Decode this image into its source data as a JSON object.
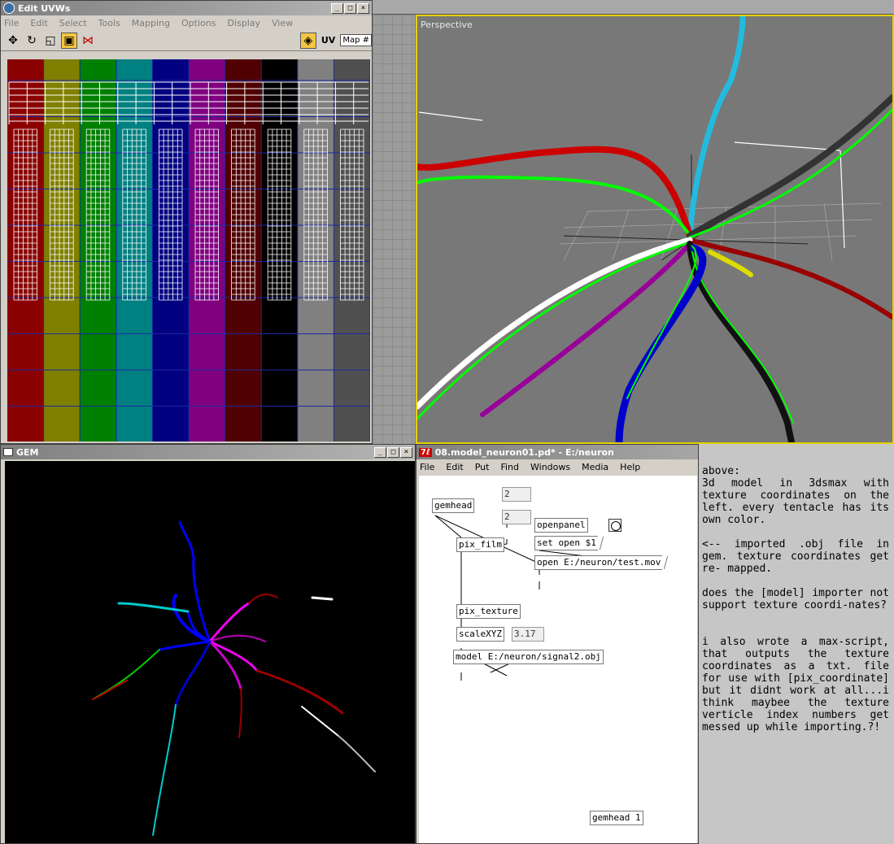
{
  "uvw": {
    "title": "Edit UVWs",
    "menus": [
      "File",
      "Edit",
      "Select",
      "Tools",
      "Mapping",
      "Options",
      "Display",
      "View"
    ],
    "tools": [
      "move-icon",
      "rotate-icon",
      "scale-icon",
      "freeform-icon",
      "mirror-icon"
    ],
    "uv_label": "UV",
    "map_dropdown": "Map #",
    "tentacle_colors": [
      "#8b0000",
      "#808000",
      "#008000",
      "#008080",
      "#000080",
      "#800080",
      "#500000",
      "#000000",
      "#808080",
      "#505050"
    ]
  },
  "perspective": {
    "label": "Perspective"
  },
  "gem": {
    "title": "GEM"
  },
  "pd": {
    "logo": "7ℓ",
    "title": "08.model_neuron01.pd* - E:/neuron",
    "menus": [
      "File",
      "Edit",
      "Put",
      "Find",
      "Windows",
      "Media",
      "Help"
    ],
    "objects": {
      "gemhead": "gemhead",
      "num2a": "2",
      "num2b": "2",
      "openpanel": "openpanel",
      "pix_film": "pix_film",
      "set_open": "set open $1",
      "open_file": "open E:/neuron/test.mov",
      "pix_texture": "pix_texture",
      "scaleXYZ": "scaleXYZ",
      "scale_val": "3.17",
      "model": "model E:/neuron/signal2.obj",
      "gemhead1": "gemhead 1"
    }
  },
  "notes": {
    "note1": "above:\n3d model in 3dsmax with texture coordinates on the left. every tentacle has its own color.",
    "note2": "<-- imported .obj file in gem. texture coordinates get re- mapped.",
    "note3": "does the [model] importer not support texture coordi-nates?",
    "note4": "i also wrote a max-script, that outputs the texture coordinates as a txt. file for use with [pix_coordinate] but it didnt work at all...i think maybee the texture verticle index numbers get messed up while importing.?!"
  }
}
